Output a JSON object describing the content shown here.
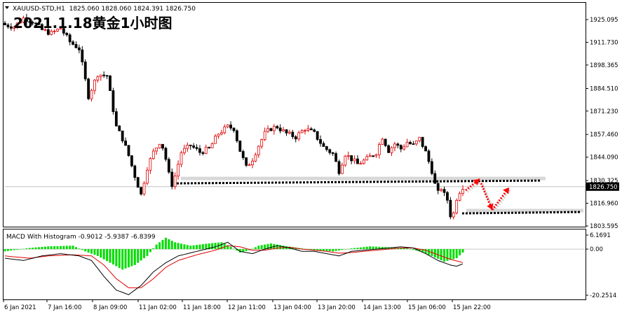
{
  "header": {
    "symbol_line": "XAUUSD-STD,H1  1825.060 1828.060 1824.391 1826.750",
    "annotation_title": "2021.1.18黄金1小时图"
  },
  "macd_header": "MACD With Histogram -0.9012 -5.9387 -6.8399",
  "colors": {
    "bull": "#e00000",
    "bear": "#000000",
    "histogram": "#00dd00",
    "signal": "#e00000",
    "macd_line": "#000000",
    "arrow": "#ff0000"
  },
  "chart_data": [
    {
      "type": "candlestick",
      "symbol": "XAUUSD-STD",
      "timeframe": "H1",
      "ylim": [
        1803.595,
        1932.0
      ],
      "y_ticks": [
        "1925.095",
        "1911.730",
        "1898.365",
        "1884.510",
        "1871.230",
        "1857.460",
        "1844.090",
        "1830.325",
        "1816.960",
        "1803.595"
      ],
      "current_price": "1826.750",
      "x_ticks": [
        "6 Jan 2021",
        "7 Jan 16:00",
        "8 Jan 09:00",
        "11 Jan 02:00",
        "11 Jan 18:00",
        "12 Jan 11:00",
        "13 Jan 04:00",
        "13 Jan 20:00",
        "14 Jan 13:00",
        "15 Jan 06:00",
        "15 Jan 22:00"
      ],
      "levels": [
        {
          "name": "support-upper",
          "price": 1829.5
        },
        {
          "name": "support-lower",
          "price": 1811.0
        }
      ],
      "close_path": [
        [
          0,
          1922
        ],
        [
          3,
          1921
        ],
        [
          6,
          1926
        ],
        [
          9,
          1924
        ],
        [
          12,
          1919
        ],
        [
          15,
          1917
        ],
        [
          18,
          1920
        ],
        [
          21,
          1912
        ],
        [
          24,
          1908
        ],
        [
          27,
          1880
        ],
        [
          30,
          1893
        ],
        [
          33,
          1892
        ],
        [
          36,
          1862
        ],
        [
          38,
          1855
        ],
        [
          40,
          1845
        ],
        [
          42,
          1833
        ],
        [
          44,
          1822
        ],
        [
          46,
          1838
        ],
        [
          48,
          1847
        ],
        [
          50,
          1853
        ],
        [
          51,
          1850
        ],
        [
          52,
          1843
        ],
        [
          53,
          1834
        ],
        [
          54,
          1828
        ],
        [
          55,
          1833
        ],
        [
          57,
          1847
        ],
        [
          60,
          1851
        ],
        [
          63,
          1847
        ],
        [
          66,
          1849
        ],
        [
          69,
          1858
        ],
        [
          72,
          1862
        ],
        [
          74,
          1861
        ],
        [
          76,
          1848
        ],
        [
          78,
          1838
        ],
        [
          80,
          1843
        ],
        [
          82,
          1851
        ],
        [
          84,
          1858
        ],
        [
          86,
          1861
        ],
        [
          88,
          1862
        ],
        [
          91,
          1858
        ],
        [
          94,
          1856
        ],
        [
          97,
          1861
        ],
        [
          100,
          1858
        ],
        [
          103,
          1850
        ],
        [
          106,
          1846
        ],
        [
          108,
          1836
        ],
        [
          110,
          1846
        ],
        [
          112,
          1843
        ],
        [
          114,
          1840
        ],
        [
          117,
          1843
        ],
        [
          120,
          1847
        ],
        [
          122,
          1856
        ],
        [
          124,
          1848
        ],
        [
          126,
          1852
        ],
        [
          128,
          1849
        ],
        [
          130,
          1853
        ],
        [
          132,
          1851
        ],
        [
          134,
          1855
        ],
        [
          136,
          1847
        ],
        [
          138,
          1836
        ],
        [
          139,
          1828
        ],
        [
          140,
          1823
        ],
        [
          141,
          1826
        ],
        [
          142,
          1822
        ],
        [
          143,
          1819
        ],
        [
          144,
          1810
        ],
        [
          145,
          1811
        ],
        [
          146,
          1820
        ],
        [
          147,
          1824
        ],
        [
          148,
          1826.75
        ]
      ]
    },
    {
      "type": "macd",
      "title": "MACD With Histogram",
      "values": {
        "macd": -0.9012,
        "signal": -5.9387,
        "histogram": -6.8399
      },
      "ylim": [
        -20.2514,
        6.1691
      ],
      "y_ticks": [
        "6.1691",
        "0.00",
        "-20.2514"
      ],
      "histogram_path": [
        [
          0,
          -1
        ],
        [
          8,
          0.5
        ],
        [
          14,
          1.2
        ],
        [
          22,
          1.5
        ],
        [
          26,
          -1
        ],
        [
          30,
          -3
        ],
        [
          34,
          -6
        ],
        [
          38,
          -9
        ],
        [
          42,
          -7
        ],
        [
          46,
          -3
        ],
        [
          49,
          2
        ],
        [
          52,
          5
        ],
        [
          55,
          3
        ],
        [
          60,
          1.5
        ],
        [
          66,
          2.5
        ],
        [
          70,
          3
        ],
        [
          73,
          1
        ],
        [
          76,
          -1.5
        ],
        [
          79,
          -0.5
        ],
        [
          82,
          1.5
        ],
        [
          86,
          2.5
        ],
        [
          90,
          1.5
        ],
        [
          95,
          0.5
        ],
        [
          100,
          -0.5
        ],
        [
          106,
          -1
        ],
        [
          112,
          0.3
        ],
        [
          118,
          1.2
        ],
        [
          124,
          0.8
        ],
        [
          130,
          0.3
        ],
        [
          134,
          -1
        ],
        [
          138,
          -3
        ],
        [
          142,
          -5.5
        ],
        [
          146,
          -4
        ],
        [
          148,
          -1.5
        ]
      ],
      "macd_path": [
        [
          0,
          -4
        ],
        [
          6,
          -5
        ],
        [
          12,
          -3
        ],
        [
          18,
          -2
        ],
        [
          24,
          -3
        ],
        [
          28,
          -5
        ],
        [
          32,
          -12
        ],
        [
          36,
          -18
        ],
        [
          40,
          -20
        ],
        [
          44,
          -16
        ],
        [
          48,
          -10
        ],
        [
          52,
          -6
        ],
        [
          56,
          -3
        ],
        [
          62,
          -1
        ],
        [
          68,
          1
        ],
        [
          72,
          3
        ],
        [
          76,
          -1
        ],
        [
          80,
          -2
        ],
        [
          84,
          0
        ],
        [
          88,
          1.5
        ],
        [
          92,
          0.5
        ],
        [
          96,
          -1
        ],
        [
          100,
          -1
        ],
        [
          104,
          -2
        ],
        [
          108,
          -3
        ],
        [
          112,
          -1
        ],
        [
          116,
          -0.5
        ],
        [
          120,
          0
        ],
        [
          124,
          0.5
        ],
        [
          128,
          1
        ],
        [
          132,
          0.5
        ],
        [
          136,
          -2
        ],
        [
          140,
          -5
        ],
        [
          144,
          -7
        ],
        [
          146,
          -7.5
        ],
        [
          148,
          -6.5
        ]
      ],
      "signal_path": [
        [
          0,
          -3
        ],
        [
          8,
          -4
        ],
        [
          14,
          -3
        ],
        [
          22,
          -2.5
        ],
        [
          28,
          -3
        ],
        [
          32,
          -7
        ],
        [
          36,
          -13
        ],
        [
          40,
          -17
        ],
        [
          44,
          -17
        ],
        [
          48,
          -13
        ],
        [
          52,
          -8
        ],
        [
          56,
          -5
        ],
        [
          62,
          -2.5
        ],
        [
          68,
          -0.5
        ],
        [
          72,
          1.5
        ],
        [
          76,
          1
        ],
        [
          80,
          -0.5
        ],
        [
          84,
          -0.5
        ],
        [
          88,
          0.5
        ],
        [
          92,
          0.8
        ],
        [
          96,
          0
        ],
        [
          100,
          -0.5
        ],
        [
          104,
          -1
        ],
        [
          108,
          -1.8
        ],
        [
          112,
          -1.5
        ],
        [
          116,
          -1
        ],
        [
          120,
          -0.5
        ],
        [
          124,
          0
        ],
        [
          128,
          0.5
        ],
        [
          132,
          0.5
        ],
        [
          136,
          -0.5
        ],
        [
          140,
          -2.5
        ],
        [
          144,
          -4.5
        ],
        [
          148,
          -5.9
        ]
      ]
    }
  ]
}
